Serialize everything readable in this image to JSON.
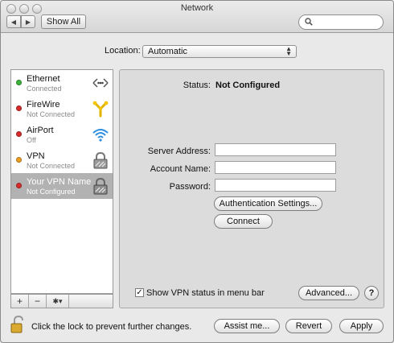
{
  "window": {
    "title": "Network"
  },
  "toolbar": {
    "show_all_label": "Show All",
    "search_placeholder": ""
  },
  "location": {
    "label": "Location:",
    "value": "Automatic"
  },
  "services": [
    {
      "name": "Ethernet",
      "status": "Connected",
      "status_color": "#3cb43c",
      "icon": "ethernet-icon"
    },
    {
      "name": "FireWire",
      "status": "Not Connected",
      "status_color": "#d92b2b",
      "icon": "firewire-icon"
    },
    {
      "name": "AirPort",
      "status": "Off",
      "status_color": "#d92b2b",
      "icon": "airport-icon"
    },
    {
      "name": "VPN",
      "status": "Not Connected",
      "status_color": "#f0a020",
      "icon": "vpn-lock-icon"
    },
    {
      "name": "Your VPN Name",
      "status": "Not Configured",
      "status_color": "#d92b2b",
      "icon": "vpn-lock-icon"
    }
  ],
  "sidebar_controls": {
    "add": "+",
    "remove": "−",
    "action": "✱▾"
  },
  "detail": {
    "status_label": "Status:",
    "status_value": "Not Configured",
    "server_label": "Server Address:",
    "server_value": "",
    "account_label": "Account Name:",
    "account_value": "",
    "password_label": "Password:",
    "password_value": "",
    "auth_button": "Authentication Settings...",
    "connect_button": "Connect",
    "show_status_label": "Show VPN status in menu bar",
    "show_status_checked": true,
    "advanced_button": "Advanced...",
    "help_label": "?"
  },
  "footer": {
    "lock_text": "Click the lock to prevent further changes.",
    "assist_button": "Assist me...",
    "revert_button": "Revert",
    "apply_button": "Apply"
  }
}
